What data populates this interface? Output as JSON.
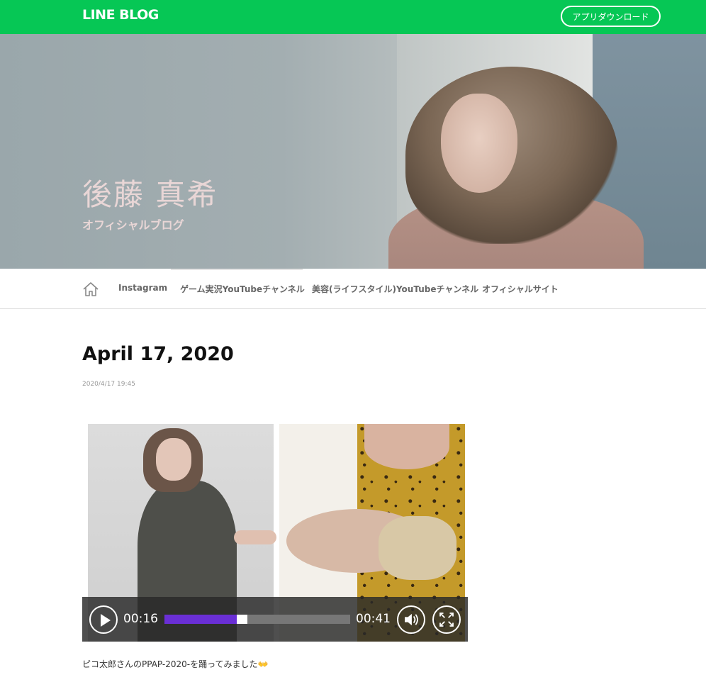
{
  "header": {
    "logo": "LINE BLOG",
    "app_download": "アプリダウンロード",
    "brand_color": "#06c755"
  },
  "hero": {
    "title": "後藤 真希",
    "subtitle": "オフィシャルブログ"
  },
  "nav": {
    "home_icon": "home-icon",
    "items": [
      {
        "label": "Instagram"
      },
      {
        "label": "ゲーム実況YouTubeチャンネル"
      },
      {
        "label": "美容(ライフスタイル)YouTubeチャンネル"
      },
      {
        "label": "オフィシャルサイト"
      }
    ]
  },
  "post": {
    "title": "April 17, 2020",
    "datetime": "2020/4/17 19:45",
    "caption": "ピコ太郎さんのPPAP-2020-を踊ってみました👐"
  },
  "video": {
    "current_time": "00:16",
    "duration": "00:41",
    "progress": 0.39,
    "progress_color": "#6a2fd6",
    "icons": [
      "play-icon",
      "volume-icon",
      "fullscreen-icon"
    ]
  }
}
